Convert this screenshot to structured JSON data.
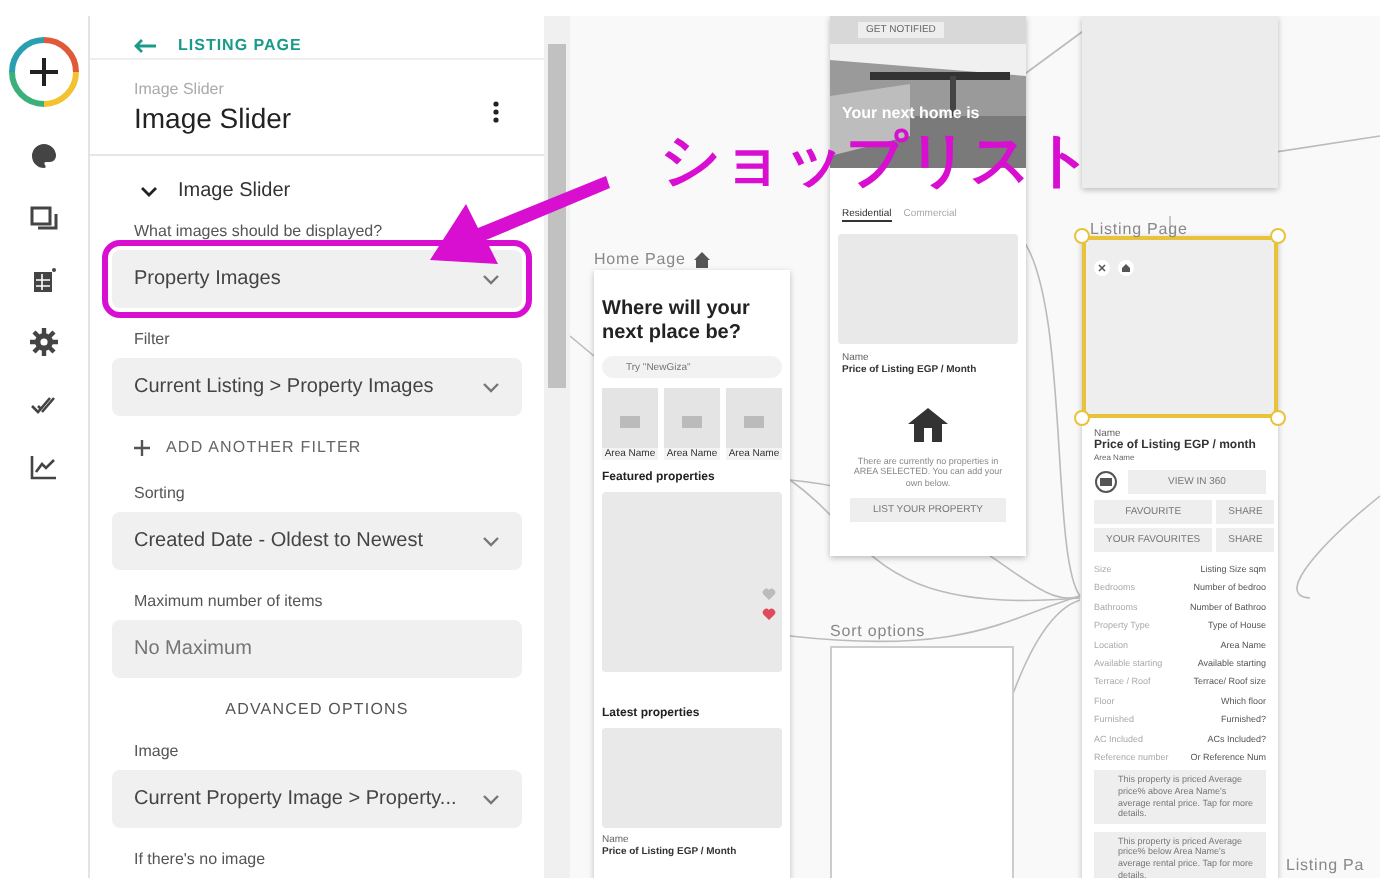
{
  "panel": {
    "back_link": "LISTING PAGE",
    "subtitle": "Image Slider",
    "title": "Image Slider",
    "section": {
      "label": "Image Slider",
      "expanded": true
    },
    "fields": [
      {
        "kind": "dropdown",
        "label": "What images should be displayed?",
        "value": "Property Images",
        "highlighted": true
      },
      {
        "kind": "dropdown",
        "label": "Filter",
        "value": "Current Listing > Property Images",
        "highlighted": false
      },
      {
        "kind": "action",
        "label": "ADD ANOTHER FILTER"
      },
      {
        "kind": "dropdown",
        "label": "Sorting",
        "value": "Created Date - Oldest to Newest",
        "highlighted": false
      },
      {
        "kind": "input",
        "label": "Maximum number of items",
        "placeholder": "No Maximum"
      },
      {
        "kind": "heading",
        "label": "ADVANCED OPTIONS"
      },
      {
        "kind": "dropdown",
        "label": "Image",
        "value": "Current Property Image > Property...",
        "highlighted": false
      },
      {
        "kind": "label",
        "label": "If there's no image"
      }
    ]
  },
  "canvas": {
    "home": {
      "label": "Home Page",
      "headline": "Where will your next place be?",
      "search_placeholder": "Try \"NewGiza\"",
      "areas": [
        "Area Name",
        "Area Name",
        "Area Name"
      ],
      "featured": "Featured properties",
      "latest": "Latest properties",
      "name": "Name",
      "price": "Price of Listing EGP / Month"
    },
    "onboarding": {
      "notify": "GET NOTIFIED",
      "hero": "Your next home is",
      "tabs": [
        {
          "label": "Residential",
          "selected": true
        },
        {
          "label": "Commercial",
          "selected": false
        }
      ],
      "name": "Name",
      "price": "Price of Listing EGP / Month",
      "empty": "There are currently no properties in AREA SELECTED. You can add your own below.",
      "button": "LIST YOUR PROPERTY"
    },
    "sort_label": "Sort options",
    "listing": {
      "label": "Listing Page",
      "selected": true,
      "name": "Name",
      "price": "Price of Listing EGP / month",
      "area": "Area Name",
      "view_button": "VIEW IN 360",
      "buttons": [
        "FAVOURITE",
        "SHARE",
        "YOUR FAVOURITES",
        "SHARE"
      ],
      "details": [
        {
          "label": "Size",
          "value": "Listing Size sqm"
        },
        {
          "label": "Bedrooms",
          "value": "Number of bedroo"
        },
        {
          "label": "Bathrooms",
          "value": "Number of Bathroo"
        },
        {
          "label": "Property Type",
          "value": "Type of House"
        },
        {
          "label": "Location",
          "value": "Area Name"
        },
        {
          "label": "Available starting",
          "value": "Available starting"
        },
        {
          "label": "Terrace / Roof",
          "value": "Terrace/ Roof size"
        },
        {
          "label": "Floor",
          "value": "Which floor"
        },
        {
          "label": "Furnished",
          "value": "Furnished?"
        },
        {
          "label": "AC Included",
          "value": "ACs Included?"
        },
        {
          "label": "Reference number",
          "value": "Or Reference Num"
        }
      ],
      "notes": [
        "This property is priced Average price% above Area Name's average rental price. Tap for more details.",
        "This property is priced Average price% below Area Name's average rental price. Tap for more details."
      ]
    },
    "edge_label": "Listing Pa"
  },
  "annotation": {
    "text": "ショップリスト"
  }
}
